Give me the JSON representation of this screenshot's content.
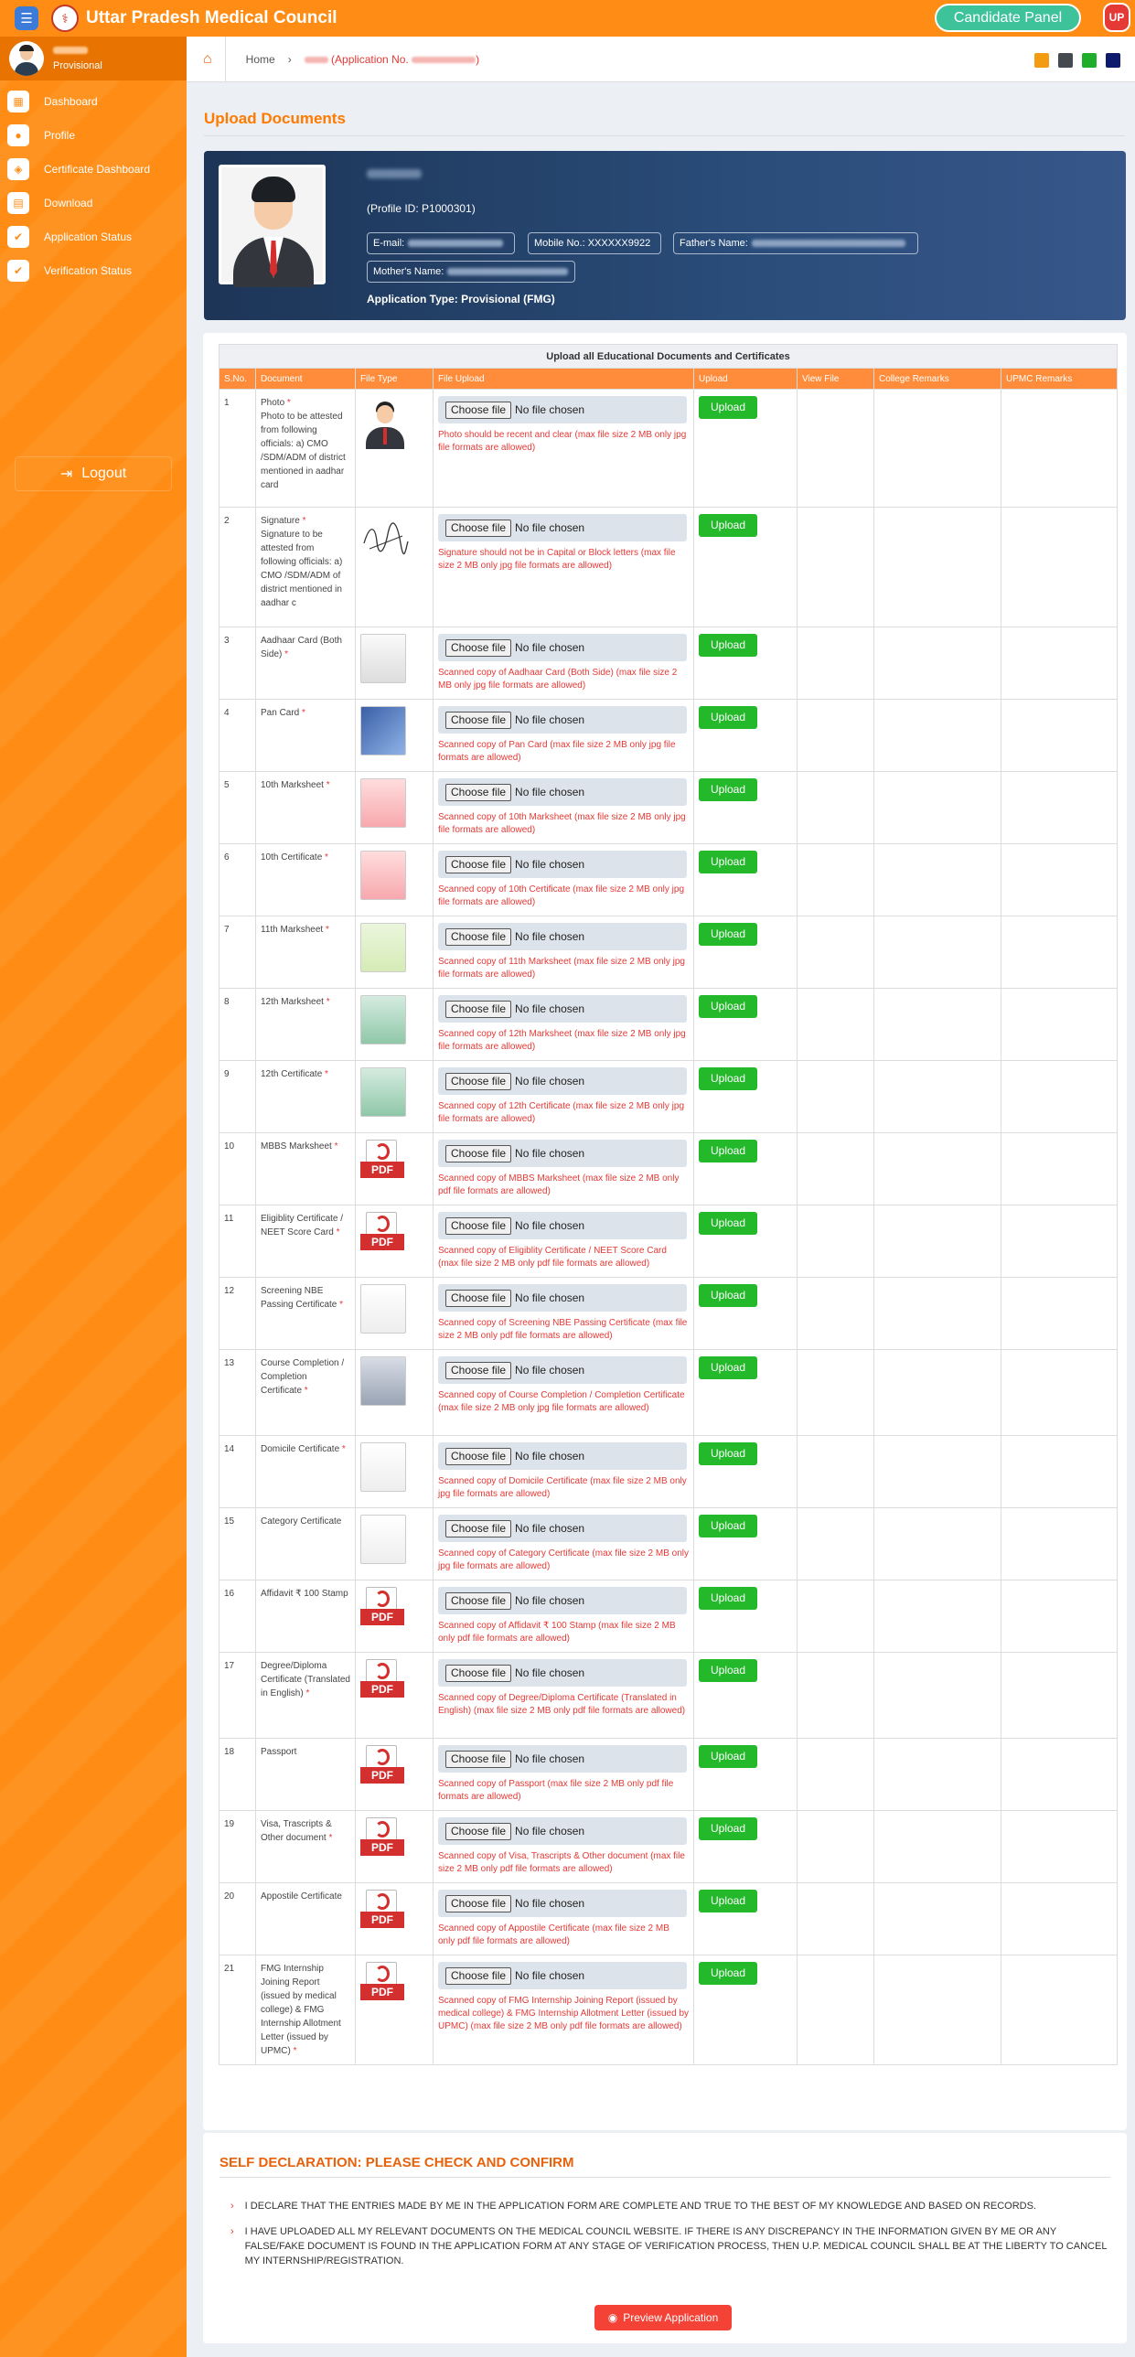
{
  "header": {
    "title": "Uttar Pradesh Medical Council",
    "candidate_panel": "Candidate Panel",
    "badge": "UP"
  },
  "sidebar": {
    "user_status": "Provisional",
    "items": [
      {
        "label": "Dashboard",
        "icon": "grid-icon"
      },
      {
        "label": "Profile",
        "icon": "user-icon"
      },
      {
        "label": "Certificate Dashboard",
        "icon": "certificate-icon"
      },
      {
        "label": "Download",
        "icon": "download-icon"
      },
      {
        "label": "Application Status",
        "icon": "check-circle-icon"
      },
      {
        "label": "Verification Status",
        "icon": "check-circle-icon"
      }
    ],
    "logout": "Logout"
  },
  "breadcrumb": {
    "home": "Home",
    "application": "(Application No."
  },
  "page_title": "Upload Documents",
  "profile": {
    "profile_id": "(Profile ID: P1000301)",
    "email_label": "E-mail:",
    "mobile_label": "Mobile No.: XXXXXX9922",
    "father_label": "Father's Name:",
    "mother_label": "Mother's Name:",
    "application_type": "Application Type: Provisional (FMG)"
  },
  "table": {
    "caption": "Upload all Educational Documents and Certificates",
    "columns": [
      "S.No.",
      "Document",
      "File Type",
      "File Upload",
      "Upload",
      "View File",
      "College Remarks",
      "UPMC Remarks"
    ],
    "choose_label": "Choose file",
    "no_file": "No file chosen",
    "upload_label": "Upload",
    "rows": [
      {
        "no": "1",
        "doc": "Photo",
        "req": true,
        "sub": "Photo to be attested from following officials: a) CMO /SDM/ADM of district mentioned in aadhar card",
        "type": "photo",
        "hint": "Photo should be recent and clear (max file size 2 MB only jpg file formats are allowed)"
      },
      {
        "no": "2",
        "doc": "Signature",
        "req": true,
        "sub": "Signature to be attested from following officials: a) CMO /SDM/ADM of district mentioned in aadhar c",
        "type": "sign",
        "hint": "Signature should not be in Capital or Block letters (max file size 2 MB only jpg file formats are allowed)"
      },
      {
        "no": "3",
        "doc": "Aadhaar Card (Both Side)",
        "req": true,
        "sub": "",
        "type": "aadhaar",
        "hint": "Scanned copy of Aadhaar Card (Both Side) (max file size 2 MB only jpg file formats are allowed)"
      },
      {
        "no": "4",
        "doc": "Pan Card",
        "req": true,
        "sub": "",
        "type": "pan",
        "hint": "Scanned copy of Pan Card (max file size 2 MB only jpg file formats are allowed)"
      },
      {
        "no": "5",
        "doc": "10th Marksheet",
        "req": true,
        "sub": "",
        "type": "cert-red",
        "hint": "Scanned copy of 10th Marksheet (max file size 2 MB only jpg file formats are allowed)"
      },
      {
        "no": "6",
        "doc": "10th Certificate",
        "req": true,
        "sub": "",
        "type": "cert-red",
        "hint": "Scanned copy of 10th Certificate (max file size 2 MB only jpg file formats are allowed)"
      },
      {
        "no": "7",
        "doc": "11th Marksheet",
        "req": true,
        "sub": "",
        "type": "cert-green",
        "hint": "Scanned copy of 11th Marksheet (max file size 2 MB only jpg file formats are allowed)"
      },
      {
        "no": "8",
        "doc": "12th Marksheet",
        "req": true,
        "sub": "",
        "type": "cert-teal",
        "hint": "Scanned copy of 12th Marksheet (max file size 2 MB only jpg file formats are allowed)"
      },
      {
        "no": "9",
        "doc": "12th Certificate",
        "req": true,
        "sub": "",
        "type": "cert-teal",
        "hint": "Scanned copy of 12th Certificate (max file size 2 MB only jpg file formats are allowed)"
      },
      {
        "no": "10",
        "doc": "MBBS Marksheet",
        "req": true,
        "sub": "",
        "type": "pdf",
        "hint": "Scanned copy of MBBS Marksheet (max file size 2 MB only pdf file formats are allowed)"
      },
      {
        "no": "11",
        "doc": "Eligiblity Certificate / NEET Score Card",
        "req": true,
        "sub": "",
        "type": "pdf",
        "hint": "Scanned copy of Eligiblity Certificate / NEET Score Card (max file size 2 MB only pdf file formats are allowed)"
      },
      {
        "no": "12",
        "doc": "Screening NBE Passing Certificate",
        "req": true,
        "sub": "",
        "type": "doc",
        "hint": "Scanned copy of Screening NBE Passing Certificate (max file size 2 MB only pdf file formats are allowed)"
      },
      {
        "no": "13",
        "doc": "Course Completion / Completion Certificate",
        "req": true,
        "sub": "",
        "type": "frame",
        "hint": "Scanned copy of Course Completion / Completion Certificate (max file size 2 MB only jpg file formats are allowed)"
      },
      {
        "no": "14",
        "doc": "Domicile Certificate",
        "req": true,
        "sub": "",
        "type": "doc",
        "hint": "Scanned copy of Domicile Certificate (max file size 2 MB only jpg file formats are allowed)"
      },
      {
        "no": "15",
        "doc": "Category Certificate",
        "req": false,
        "sub": "",
        "type": "doc",
        "hint": "Scanned copy of Category Certificate (max file size 2 MB only jpg file formats are allowed)"
      },
      {
        "no": "16",
        "doc": "Affidavit ₹ 100 Stamp",
        "req": false,
        "sub": "",
        "type": "pdf",
        "hint": "Scanned copy of Affidavit ₹ 100 Stamp (max file size 2 MB only pdf file formats are allowed)"
      },
      {
        "no": "17",
        "doc": "Degree/Diploma Certificate (Translated in English)",
        "req": true,
        "sub": "",
        "type": "pdf",
        "hint": "Scanned copy of Degree/Diploma Certificate (Translated in English) (max file size 2 MB only pdf file formats are allowed)"
      },
      {
        "no": "18",
        "doc": "Passport",
        "req": false,
        "sub": "",
        "type": "pdf",
        "hint": "Scanned copy of Passport (max file size 2 MB only pdf file formats are allowed)"
      },
      {
        "no": "19",
        "doc": "Visa, Trascripts & Other document",
        "req": true,
        "sub": "",
        "type": "pdf",
        "hint": "Scanned copy of Visa, Trascripts & Other document (max file size 2 MB only pdf file formats are allowed)"
      },
      {
        "no": "20",
        "doc": "Appostile Certificate",
        "req": false,
        "sub": "",
        "type": "pdf",
        "hint": "Scanned copy of Appostile Certificate (max file size 2 MB only pdf file formats are allowed)"
      },
      {
        "no": "21",
        "doc": "FMG Internship Joining Report (issued by medical college) & FMG Internship Allotment Letter (issued by UPMC)",
        "req": true,
        "sub": "",
        "type": "pdf",
        "hint": "Scanned copy of FMG Internship Joining Report (issued by medical college) & FMG Internship Allotment Letter (issued by UPMC) (max file size 2 MB only pdf file formats are allowed)"
      }
    ]
  },
  "declaration": {
    "title": "SELF DECLARATION: PLEASE CHECK AND CONFIRM",
    "items": [
      "I DECLARE THAT THE ENTRIES MADE BY ME IN THE APPLICATION FORM ARE COMPLETE AND TRUE TO THE BEST OF MY KNOWLEDGE AND BASED ON RECORDS.",
      "I HAVE UPLOADED ALL MY RELEVANT DOCUMENTS ON THE MEDICAL COUNCIL WEBSITE. IF THERE IS ANY DISCREPANCY IN THE INFORMATION GIVEN BY ME OR ANY FALSE/FAKE DOCUMENT IS FOUND IN THE APPLICATION FORM AT ANY STAGE OF VERIFICATION PROCESS, THEN U.P. MEDICAL COUNCIL SHALL BE AT THE LIBERTY TO CANCEL MY INTERNSHIP/REGISTRATION."
    ],
    "preview": "Preview Application"
  },
  "colors": {
    "accent": "#ff8c14",
    "upload": "#24b82b",
    "hint": "#e53935"
  },
  "swatch_colors": [
    "#f39c12",
    "#444a50",
    "#1eae2c",
    "#0d1a6e"
  ]
}
